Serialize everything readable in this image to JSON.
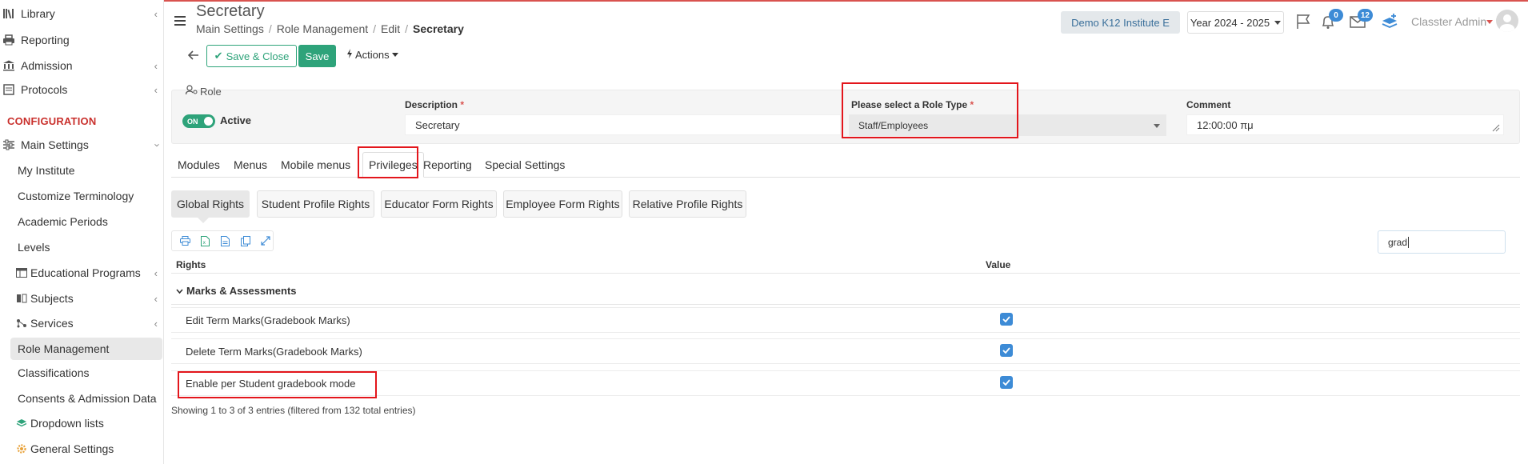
{
  "sidebar": {
    "items": [
      {
        "label": "Library",
        "icon": "library-icon",
        "chevron": true
      },
      {
        "label": "Reporting",
        "icon": "printer-icon",
        "chevron": false
      },
      {
        "label": "Admission",
        "icon": "bank-icon",
        "chevron": true
      },
      {
        "label": "Protocols",
        "icon": "protocol-icon",
        "chevron": true
      }
    ],
    "section_title": "CONFIGURATION",
    "main_settings": {
      "label": "Main Settings",
      "icon": "sliders-icon"
    },
    "sub_items": [
      "My Institute",
      "Customize Terminology",
      "Academic Periods",
      "Levels",
      "Educational Programs",
      "Subjects",
      "Services",
      "Role Management",
      "Classifications",
      "Consents & Admission Data",
      "Dropdown lists",
      "General Settings"
    ]
  },
  "header": {
    "title": "Secretary",
    "breadcrumb": [
      "Main Settings",
      "Role Management",
      "Edit",
      "Secretary"
    ],
    "institute": "Demo K12 Institute E",
    "year": "Year 2024 - 2025",
    "notifications_count": "0",
    "messages_count": "12",
    "user_name": "Classter Admin"
  },
  "toolbar": {
    "save_close_label": "Save & Close",
    "save_label": "Save",
    "actions_label": "Actions"
  },
  "form": {
    "section_label": "Role",
    "toggle_text": "ON",
    "active_label": "Active",
    "description_label": "Description",
    "description_value": "Secretary",
    "role_type_label": "Please select a Role Type",
    "role_type_value": "Staff/Employees",
    "comment_label": "Comment",
    "comment_value": "12:00:00 πμ"
  },
  "tabs": [
    "Modules",
    "Menus",
    "Mobile menus",
    "Privileges",
    "Reporting",
    "Special Settings"
  ],
  "sub_tabs": [
    "Global Rights",
    "Student Profile Rights",
    "Educator Form Rights",
    "Employee Form Rights",
    "Relative Profile Rights"
  ],
  "table": {
    "search_value": "grad",
    "col_rights": "Rights",
    "col_value": "Value",
    "group": "Marks & Assessments",
    "rows": [
      {
        "label": "Edit Term Marks(Gradebook Marks)",
        "checked": true
      },
      {
        "label": "Delete Term Marks(Gradebook Marks)",
        "checked": true
      },
      {
        "label": "Enable per Student gradebook mode",
        "checked": true
      }
    ],
    "info": "Showing 1 to 3 of 3 entries (filtered from 132 total entries)"
  },
  "colors": {
    "accent_green": "#2ea37a",
    "accent_blue": "#3d8bd6",
    "config_red": "#c9302c",
    "highlight_red": "#e3161c"
  }
}
